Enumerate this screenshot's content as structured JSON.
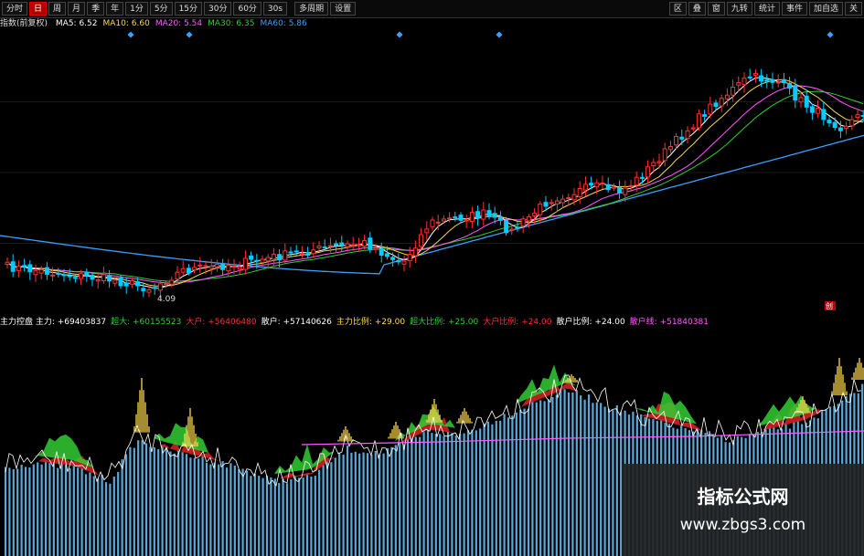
{
  "toolbar": {
    "periods": [
      {
        "label": "分时",
        "active": false
      },
      {
        "label": "日",
        "active": true
      },
      {
        "label": "周",
        "active": false
      },
      {
        "label": "月",
        "active": false
      },
      {
        "label": "季",
        "active": false
      },
      {
        "label": "年",
        "active": false
      },
      {
        "label": "1分",
        "active": false
      },
      {
        "label": "5分",
        "active": false
      },
      {
        "label": "15分",
        "active": false
      },
      {
        "label": "30分",
        "active": false
      },
      {
        "label": "60分",
        "active": false
      },
      {
        "label": "30s",
        "active": false
      }
    ],
    "extra_buttons": [
      "多周期",
      "设置"
    ],
    "right_buttons": [
      "区",
      "叠",
      "窗",
      "九转",
      "统计",
      "事件",
      "加自选",
      "关"
    ]
  },
  "price_legend": {
    "name": "指数(前复权)",
    "items": [
      {
        "label": "MA5: 6.52",
        "color": "#ffffff"
      },
      {
        "label": "MA10: 6.60",
        "color": "#ffd84a"
      },
      {
        "label": "MA20: 5.54",
        "color": "#ff5bff"
      },
      {
        "label": "MA30: 6.35",
        "color": "#33cc33"
      },
      {
        "label": "MA60: 5.86",
        "color": "#3aa0ff"
      }
    ]
  },
  "price_annotations": {
    "low_label": "4.09",
    "marker_label": "创"
  },
  "indicator_legend": {
    "items": [
      {
        "label": "主力控盘 主力: +69403837",
        "color": "#ffffff"
      },
      {
        "label": "超大: +60155523",
        "color": "#33cc33"
      },
      {
        "label": "大户: +56406480",
        "color": "#ff3030"
      },
      {
        "label": "散户: +57140626",
        "color": "#ffffff"
      },
      {
        "label": "主力比例: +29.00",
        "color": "#ffd84a"
      },
      {
        "label": "超大比例: +25.00",
        "color": "#33cc33"
      },
      {
        "label": "大户比例: +24.00",
        "color": "#ff3030"
      },
      {
        "label": "散户比例: +24.00",
        "color": "#ffffff"
      },
      {
        "label": "散户线: +51840381",
        "color": "#ff5bff"
      }
    ]
  },
  "watermark": {
    "title": "指标公式网",
    "url": "www.zbgs3.com"
  },
  "colors": {
    "up": "#ff3030",
    "down": "#00ccff",
    "ma5": "#ffffff",
    "ma10": "#ffd84a",
    "ma20": "#ff5bff",
    "ma30": "#33cc33",
    "ma60": "#3aa0ff",
    "retail_bar": "#5aa9d8",
    "main_fill": "#ffd84a",
    "super_fill": "#33cc33",
    "big_fill": "#d02020"
  }
}
